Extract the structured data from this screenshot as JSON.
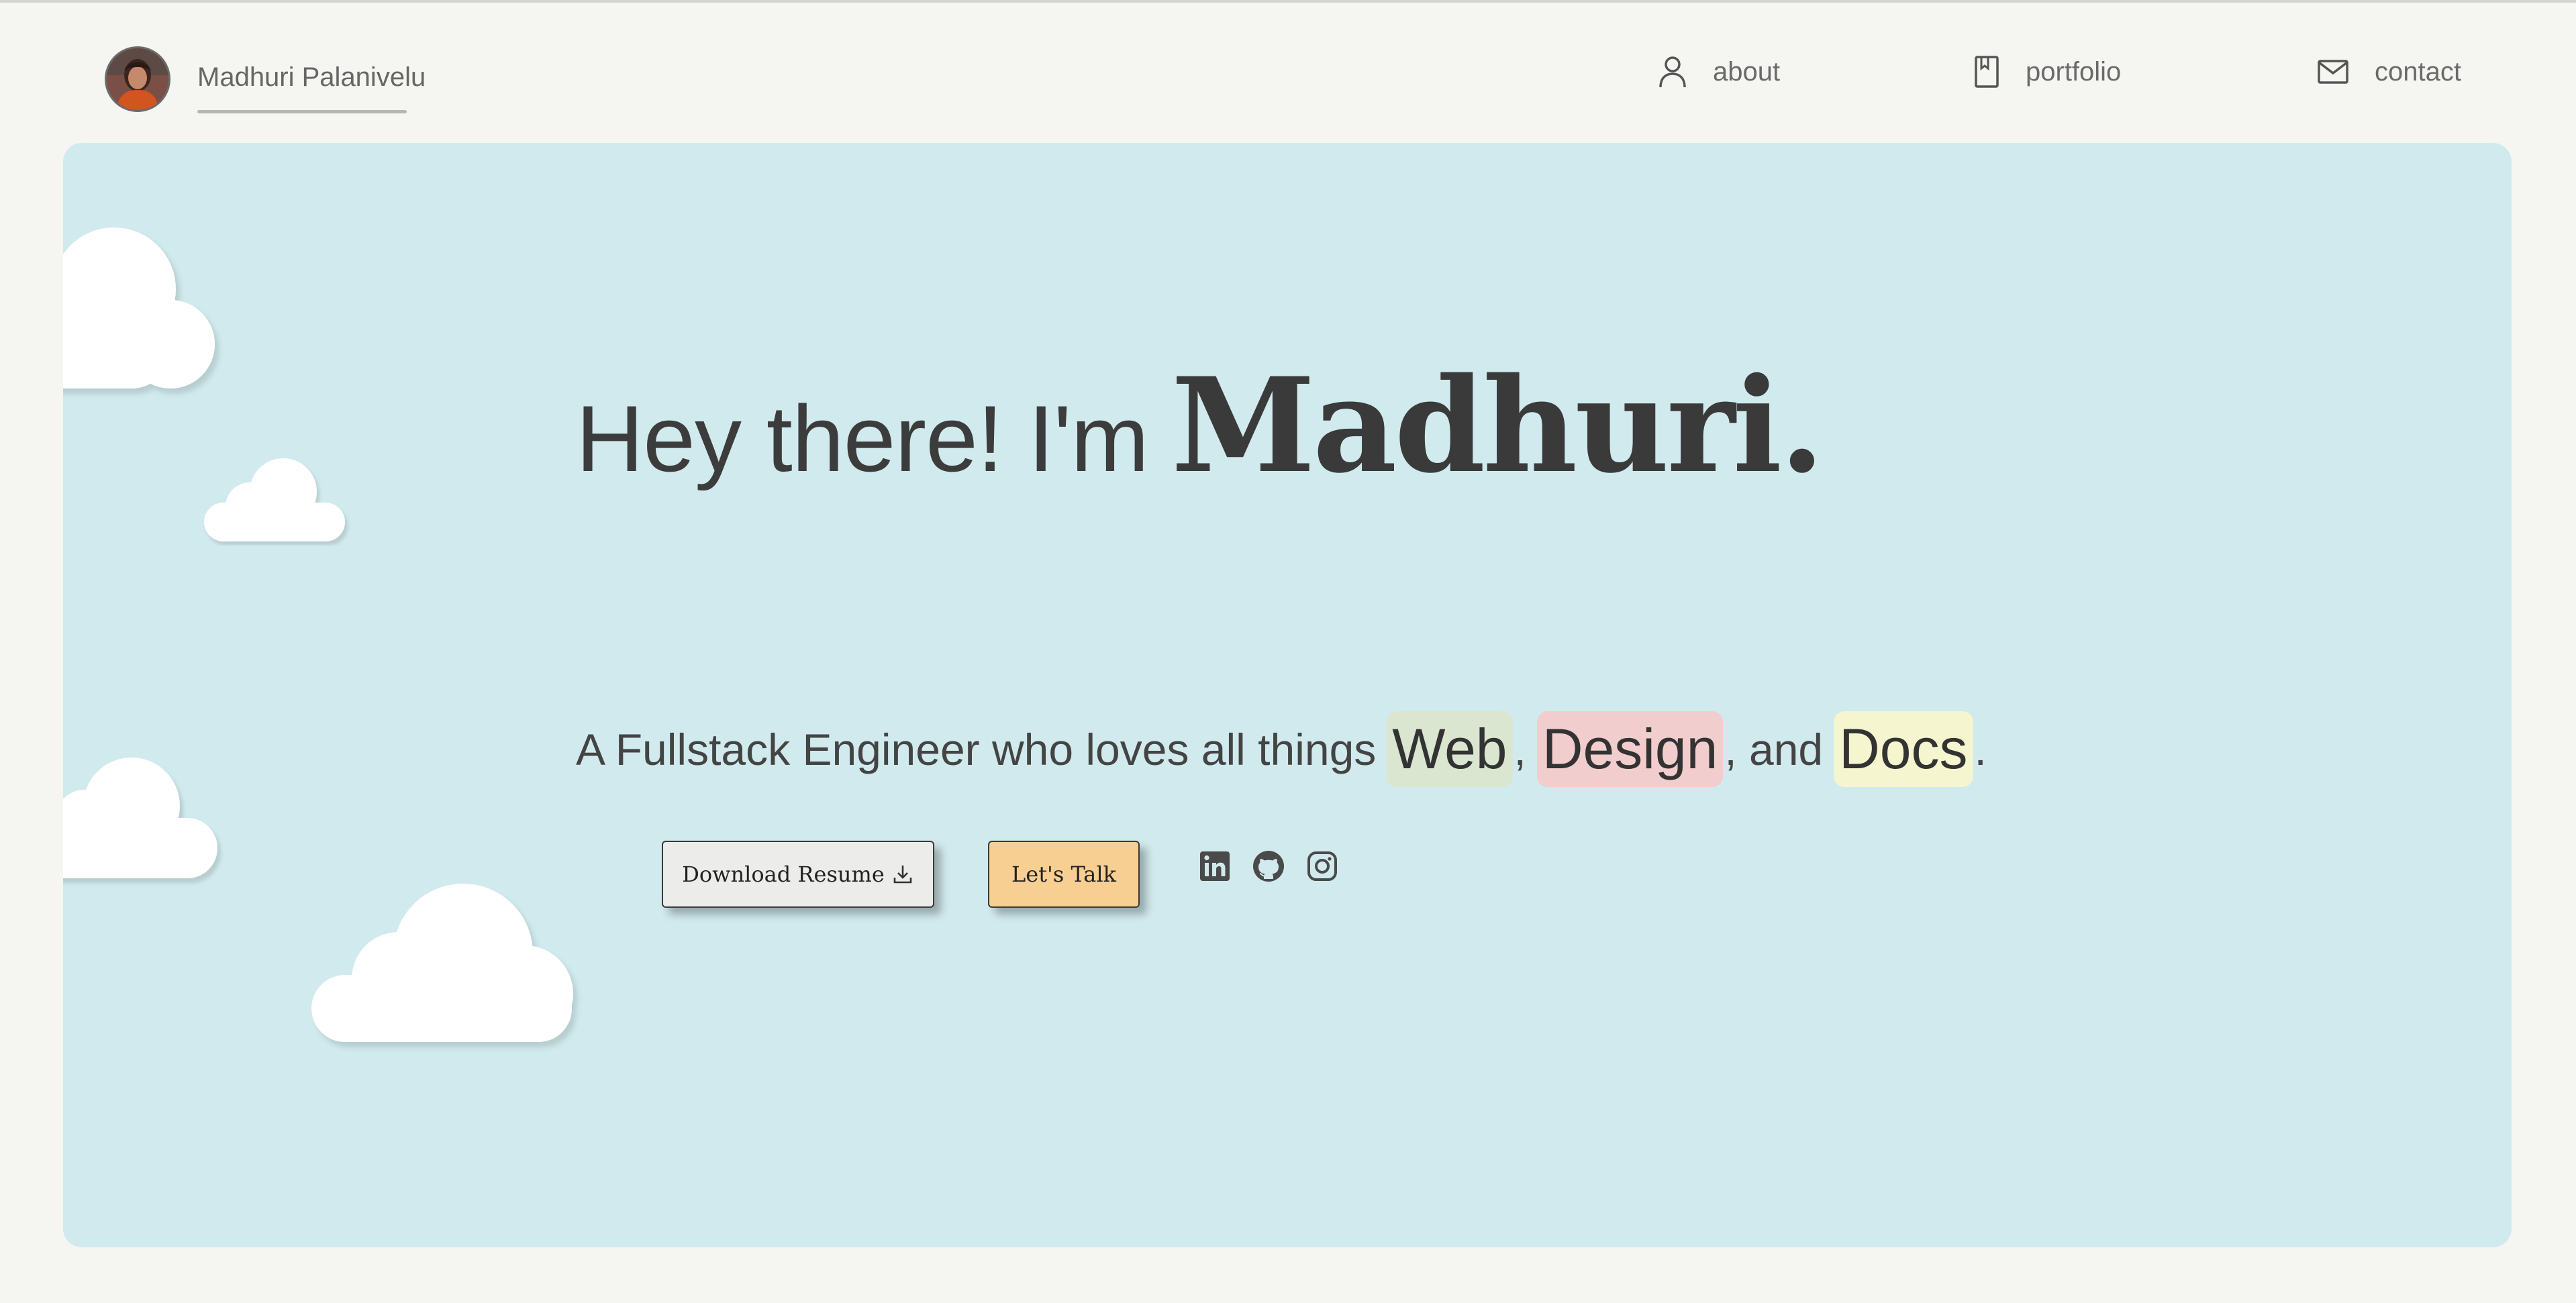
{
  "navbar": {
    "brand_name": "Madhuri Palanivelu",
    "items": [
      {
        "label": "about",
        "icon": "user-icon"
      },
      {
        "label": "portfolio",
        "icon": "bookmark-icon"
      },
      {
        "label": "contact",
        "icon": "mail-icon"
      }
    ]
  },
  "hero": {
    "greeting": "Hey there! I'm",
    "name": "Madhuri.",
    "tagline_prefix": "A Fullstack Engineer who loves all things",
    "highlights": [
      "Web",
      "Design",
      "Docs"
    ],
    "sep_comma": ",",
    "sep_and": ", and",
    "sep_period": ".",
    "buttons": {
      "resume": "Download Resume",
      "talk": "Let's Talk"
    },
    "social_icons": [
      "linkedin-icon",
      "github-icon",
      "instagram-icon"
    ]
  },
  "colors": {
    "page_bg": "#f5f5f1",
    "hero_bg": "#d1eaed",
    "highlight_web": "#dae6d0",
    "highlight_design": "#f2cdcd",
    "highlight_docs": "#f5f6cf",
    "talk_button": "#f7cf92",
    "resume_button": "#ececea"
  }
}
